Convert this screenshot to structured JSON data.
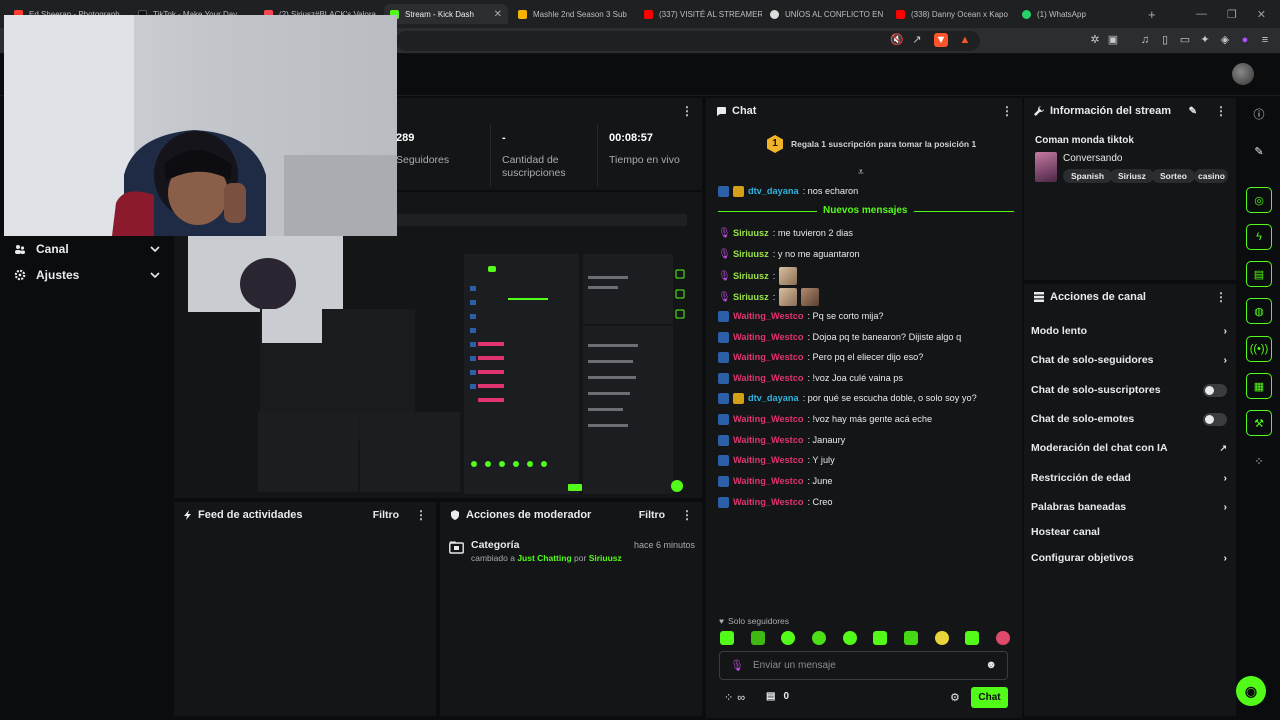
{
  "browser": {
    "tabs": [
      {
        "title": "Ed Sheeran - Photograph",
        "color": "#ff3b30"
      },
      {
        "title": "TikTok - Make Your Day",
        "color": "#111111"
      },
      {
        "title": "(2) Siriusz#BLACK's Valora",
        "color": "#ff4655"
      },
      {
        "title": "Stream - Kick Dash",
        "color": "#53fc18",
        "active": true
      },
      {
        "title": "Mashle 2nd Season 3 Sub",
        "color": "#f4b400"
      },
      {
        "title": "(337) VISITÉ AL STREAMER",
        "color": "#ff0000"
      },
      {
        "title": "UNÍOS AL CONFLICTO EN",
        "color": "#dddddd"
      },
      {
        "title": "(338) Danny Ocean x Kapo",
        "color": "#ff0000"
      },
      {
        "title": "(1) WhatsApp",
        "color": "#25d366"
      }
    ]
  },
  "sidebar": {
    "items": [
      {
        "label": "Canal"
      },
      {
        "label": "Ajustes"
      }
    ]
  },
  "stats": {
    "followers_value": "289",
    "followers_label": "Seguidores",
    "subs_value": "-",
    "subs_label_1": "Cantidad de",
    "subs_label_2": "suscripciones",
    "live_value": "00:08:57",
    "live_label": "Tiempo en vivo"
  },
  "activity_feed": {
    "title": "Feed de actividades",
    "filter": "Filtro"
  },
  "mod_actions": {
    "title": "Acciones de moderador",
    "filter": "Filtro",
    "entry": {
      "title": "Categoría",
      "time": "hace 6 minutos",
      "prefix": "cambiado a",
      "category": "Just Chatting",
      "by": "por",
      "user": "Siriuusz"
    }
  },
  "chat": {
    "title": "Chat",
    "gift_count": "1",
    "gift_text": "Regala 1 suscripción para tomar la posición 1",
    "new_messages": "Nuevos mensajes",
    "messages": [
      {
        "badge": "mod-crown",
        "user": "dtv_dayana",
        "color": "cyan",
        "text": ": nos echaron"
      },
      {
        "badge": "mic",
        "user": "Siriuusz",
        "color": "green",
        "text": ": me tuvieron 2 dias"
      },
      {
        "badge": "mic",
        "user": "Siriuusz",
        "color": "green",
        "text": ": y no me aguantaron"
      },
      {
        "badge": "mic",
        "user": "Siriuusz",
        "color": "green",
        "text": ":",
        "emotes": 1
      },
      {
        "badge": "mic",
        "user": "Siriuusz",
        "color": "green",
        "text": ":",
        "emotes": 2
      },
      {
        "badge": "mod",
        "user": "Waiting_Westco",
        "color": "pink",
        "text": ": Pq se corto mija?"
      },
      {
        "badge": "mod",
        "user": "Waiting_Westco",
        "color": "pink",
        "text": ": Dojoa pq te banearon? Dijiste algo q"
      },
      {
        "badge": "mod",
        "user": "Waiting_Westco",
        "color": "pink",
        "text": ": Pero pq el eliecer dijo eso?"
      },
      {
        "badge": "mod",
        "user": "Waiting_Westco",
        "color": "pink",
        "text": ": !voz Joa culé vaina ps"
      },
      {
        "badge": "mod-crown",
        "user": "dtv_dayana",
        "color": "cyan",
        "text": ": por qué se escucha doble, o solo soy yo?"
      },
      {
        "badge": "mod",
        "user": "Waiting_Westco",
        "color": "pink",
        "text": ": !voz hay más gente acá eche"
      },
      {
        "badge": "mod",
        "user": "Waiting_Westco",
        "color": "pink",
        "text": ": Janaury"
      },
      {
        "badge": "mod",
        "user": "Waiting_Westco",
        "color": "pink",
        "text": ": Y july"
      },
      {
        "badge": "mod",
        "user": "Waiting_Westco",
        "color": "pink",
        "text": ": June"
      },
      {
        "badge": "mod",
        "user": "Waiting_Westco",
        "color": "pink",
        "text": ": Creo"
      }
    ],
    "followers_only": "Solo seguidores",
    "input_placeholder": "Enviar un mensaje",
    "points": "0",
    "send_label": "Chat"
  },
  "stream_info": {
    "title": "Información del stream",
    "stream_title": "Coman monda tiktok",
    "category": "Conversando",
    "tags": [
      "Spanish",
      "Siriusz",
      "Sorteo",
      "casino"
    ]
  },
  "channel_actions": {
    "title": "Acciones de canal",
    "items": [
      {
        "label": "Modo lento",
        "control": "chevron"
      },
      {
        "label": "Chat de solo-seguidores",
        "control": "chevron"
      },
      {
        "label": "Chat de solo-suscriptores",
        "control": "toggle"
      },
      {
        "label": "Chat de solo-emotes",
        "control": "toggle"
      },
      {
        "label": "Moderación del chat con IA",
        "control": "external"
      },
      {
        "label": "Restricción de edad",
        "control": "chevron"
      },
      {
        "label": "Palabras baneadas",
        "control": "chevron"
      },
      {
        "label": "Hostear canal",
        "control": "none"
      },
      {
        "label": "Configurar objetivos",
        "control": "chevron"
      }
    ]
  },
  "colors": {
    "accent": "#53fc18",
    "mod_badge": "#2b5fa8",
    "pink_user": "#e0336f",
    "cyan_user": "#2fb3e0"
  }
}
